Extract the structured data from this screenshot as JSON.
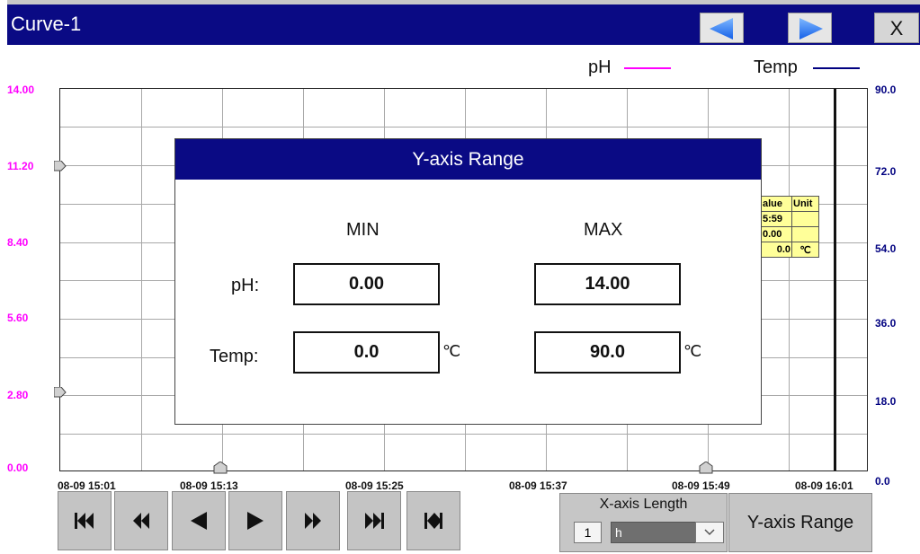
{
  "window": {
    "title": "Curve-1",
    "close_label": "X"
  },
  "legend": [
    {
      "label": "pH",
      "color": "#ff00ff"
    },
    {
      "label": "Temp",
      "color": "#000080"
    }
  ],
  "axes": {
    "left_ticks": [
      "14.00",
      "11.20",
      "8.40",
      "5.60",
      "2.80",
      "0.00"
    ],
    "right_ticks": [
      "90.0",
      "72.0",
      "54.0",
      "36.0",
      "18.0",
      "0.0"
    ],
    "x_ticks": [
      "08-09 15:01",
      "08-09 15:13",
      "08-09 15:25",
      "08-09 15:37",
      "08-09 15:49",
      "08-09 16:01"
    ]
  },
  "info_table": {
    "headers": [
      "alue",
      "Unit"
    ],
    "rows": [
      [
        "5:59",
        ""
      ],
      [
        "0.00",
        ""
      ],
      [
        "0.0",
        "℃"
      ]
    ]
  },
  "dialog": {
    "title": "Y-axis Range",
    "min_header": "MIN",
    "max_header": "MAX",
    "ph_label": "pH:",
    "temp_label": "Temp:",
    "ph_min": "0.00",
    "ph_max": "14.00",
    "temp_min": "0.0",
    "temp_max": "90.0",
    "temp_unit": "℃"
  },
  "bottom_controls": {
    "xaxis_length_label": "X-axis Length",
    "xaxis_length_value": "1",
    "xaxis_unit": "h",
    "yrange_button": "Y-axis Range"
  },
  "icons": [
    "left-arrow-icon",
    "right-arrow-icon",
    "first-icon",
    "rewind-icon",
    "prev-icon",
    "play-icon",
    "fast-forward-icon",
    "last-icon",
    "latest-icon",
    "chevron-down-icon"
  ],
  "colors": {
    "title_bar": "#0a0a84",
    "ph": "#ff00ff",
    "temp": "#000080",
    "info_bg": "#ffff99"
  }
}
